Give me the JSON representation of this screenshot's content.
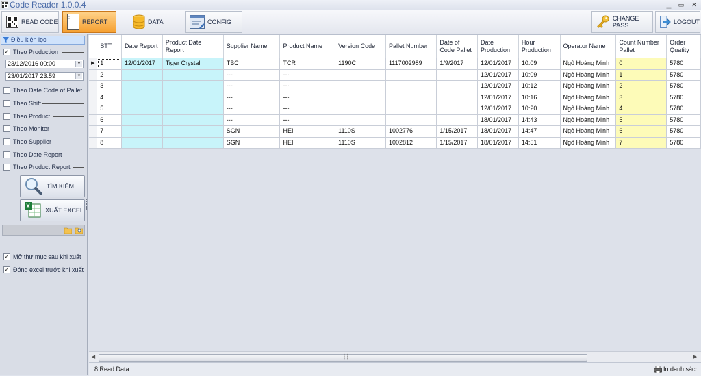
{
  "window": {
    "title": "Code Reader 1.0.0.4",
    "minimize_glyph": "▁",
    "maximize_glyph": "▭",
    "close_glyph": "✕"
  },
  "toolbar": {
    "read_code": "READ CODE",
    "report": "REPORT",
    "data": "DATA",
    "config": "CONFIG",
    "change_pass": "CHANGE PASS",
    "logout": "LOGOUT",
    "active_tab": "REPORT",
    "active_color": "#f5a030"
  },
  "sidebar": {
    "filter_header": "Điều kiện lọc",
    "theo_production": {
      "label": "Theo Production",
      "checked": true
    },
    "date_from": "23/12/2016 00:00",
    "date_to": "23/01/2017 23:59",
    "filters": [
      {
        "label": "Theo Date Code of Pallet",
        "checked": false
      },
      {
        "label": "Theo Shift",
        "checked": false
      },
      {
        "label": "Theo Product",
        "checked": false
      },
      {
        "label": "Theo Moniter",
        "checked": false
      },
      {
        "label": "Theo Supplier",
        "checked": false
      },
      {
        "label": "Theo Date Report",
        "checked": false
      },
      {
        "label": "Theo Product Report",
        "checked": false
      }
    ],
    "search_button": "TÌM KIẾM",
    "export_button": "XUẤT EXCEL",
    "open_folder_after_export": {
      "label": "Mở thư mục sau khi xuất",
      "checked": true
    },
    "close_excel_before_export": {
      "label": "Đóng excel trước khi xuất",
      "checked": true
    }
  },
  "grid": {
    "columns": [
      "STT",
      "Date Report",
      "Product Date Report",
      "Supplier Name",
      "Product Name",
      "Version Code",
      "Pallet Number",
      "Date of Code Pallet",
      "Date Production",
      "Hour Production",
      "Operator Name",
      "Count Number Pallet",
      "Order Quatity"
    ],
    "rows": [
      [
        "1",
        "12/01/2017",
        "Tiger Crystal",
        "TBC",
        "TCR",
        "1190C",
        "1117002989",
        "1/9/2017",
        "12/01/2017",
        "10:09",
        "Ngô Hoàng Minh",
        "0",
        "5780"
      ],
      [
        "2",
        "",
        "",
        "---",
        "---",
        "",
        "",
        "",
        "12/01/2017",
        "10:09",
        "Ngô Hoàng Minh",
        "1",
        "5780"
      ],
      [
        "3",
        "",
        "",
        "---",
        "---",
        "",
        "",
        "",
        "12/01/2017",
        "10:12",
        "Ngô Hoàng Minh",
        "2",
        "5780"
      ],
      [
        "4",
        "",
        "",
        "---",
        "---",
        "",
        "",
        "",
        "12/01/2017",
        "10:16",
        "Ngô Hoàng Minh",
        "3",
        "5780"
      ],
      [
        "5",
        "",
        "",
        "---",
        "---",
        "",
        "",
        "",
        "12/01/2017",
        "10:20",
        "Ngô Hoàng Minh",
        "4",
        "5780"
      ],
      [
        "6",
        "",
        "",
        "---",
        "---",
        "",
        "",
        "",
        "18/01/2017",
        "14:43",
        "Ngô Hoàng Minh",
        "5",
        "5780"
      ],
      [
        "7",
        "",
        "",
        "SGN",
        "HEI",
        "1110S",
        "1002776",
        "1/15/2017",
        "18/01/2017",
        "14:47",
        "Ngô Hoàng Minh",
        "6",
        "5780"
      ],
      [
        "8",
        "",
        "",
        "SGN",
        "HEI",
        "1110S",
        "1002812",
        "1/15/2017",
        "18/01/2017",
        "14:51",
        "Ngô Hoàng Minh",
        "7",
        "5780"
      ]
    ],
    "selected_row": 0,
    "current_row_glyph": "▶"
  },
  "statusbar": {
    "read_count": "8 Read Data",
    "print_list": "In danh sách"
  },
  "scrollbar": {
    "grip": "┆┆┆"
  },
  "colors": {
    "date_report_bg": "#c8f4fa",
    "count_number_bg": "#fdfbb8"
  }
}
